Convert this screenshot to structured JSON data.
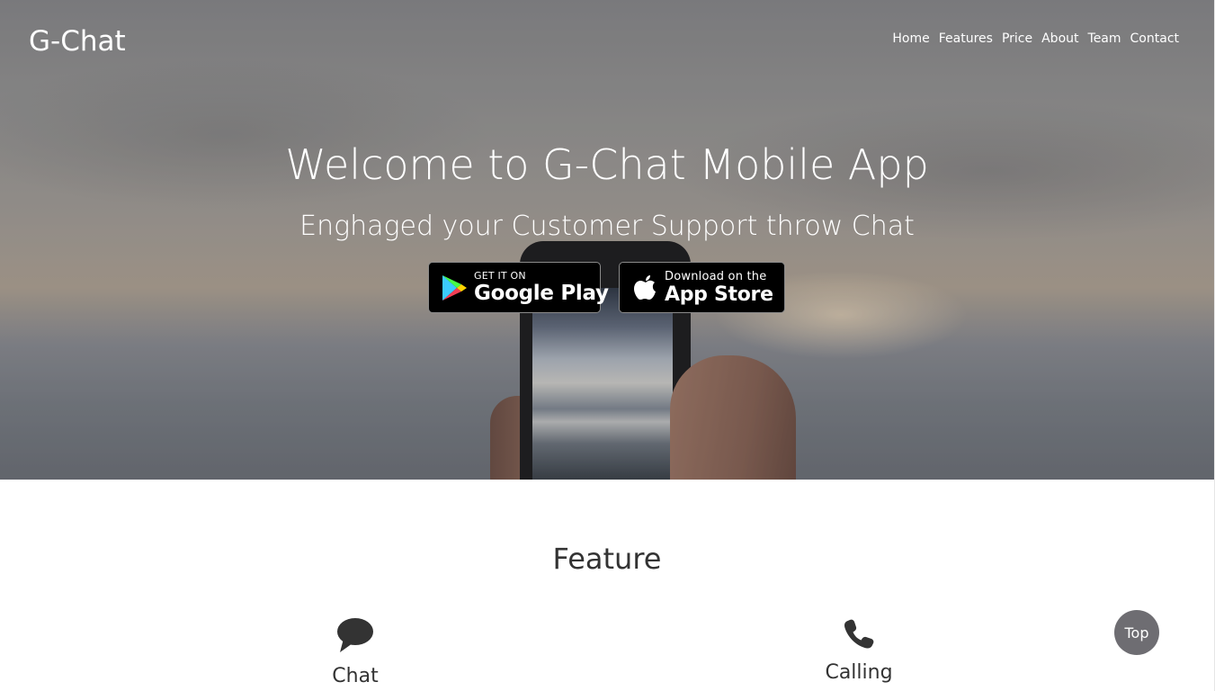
{
  "header": {
    "brand": "G-Chat",
    "nav": [
      "Home",
      "Features",
      "Price",
      "About",
      "Team",
      "Contact"
    ]
  },
  "hero": {
    "title": "Welcome to G-Chat Mobile App",
    "subtitle": "Enghaged your Customer Support throw Chat",
    "google_play": {
      "small": "GET IT ON",
      "big": "Google Play",
      "icon": "google-play-icon"
    },
    "app_store": {
      "small": "Download on the",
      "big": "App Store",
      "icon": "apple-icon"
    }
  },
  "features": {
    "heading": "Feature",
    "items": [
      {
        "label": "Chat",
        "icon": "chat-bubble-icon"
      },
      {
        "label": "Calling",
        "icon": "phone-icon"
      }
    ]
  },
  "top_button": "Top"
}
